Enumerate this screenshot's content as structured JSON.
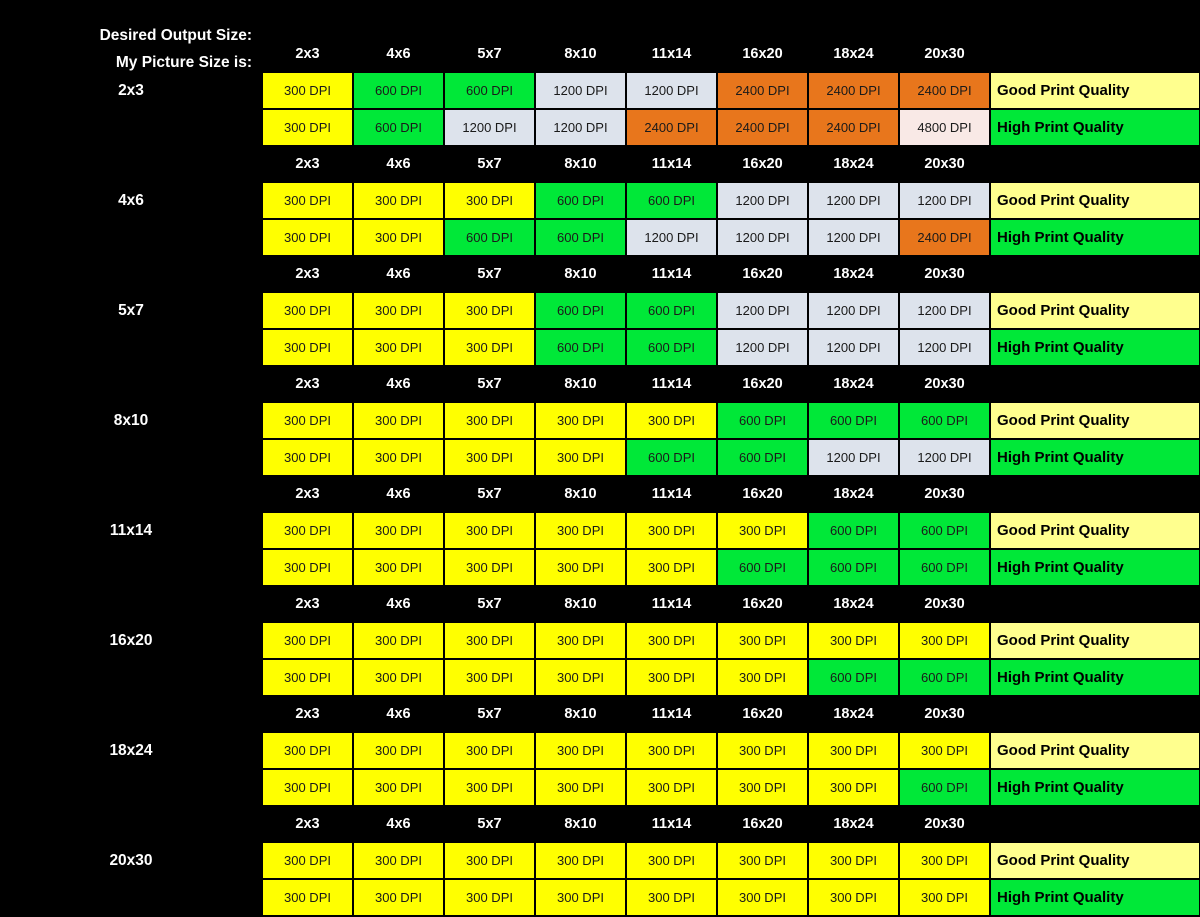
{
  "header": {
    "desired_output_size_label": "Desired Output Size:",
    "my_picture_size_label": "My Picture Size is:"
  },
  "colors": {
    "background": "#000000",
    "yellow": "#ffff00",
    "green": "#00e838",
    "blue": "#dde3ec",
    "orange": "#e8761c",
    "pink": "#f9e9e6",
    "good_quality_bg": "#ffff8e",
    "high_quality_bg": "#00e838",
    "label_text": "#ffffff"
  },
  "columns": [
    "2x3",
    "4x6",
    "5x7",
    "8x10",
    "11x14",
    "16x20",
    "18x24",
    "20x30"
  ],
  "quality_labels": {
    "good": "Good Print Quality",
    "high": "High Print Quality"
  },
  "blocks": [
    {
      "row_label": "2x3",
      "columns": [
        "2x3",
        "4x6",
        "5x7",
        "8x10",
        "11x14",
        "16x20",
        "18x24",
        "20x30"
      ],
      "good": [
        {
          "text": "300 DPI",
          "color": "yellow"
        },
        {
          "text": "600 DPI",
          "color": "green"
        },
        {
          "text": "600 DPI",
          "color": "green"
        },
        {
          "text": "1200 DPI",
          "color": "blue"
        },
        {
          "text": "1200 DPI",
          "color": "blue"
        },
        {
          "text": "2400 DPI",
          "color": "orange"
        },
        {
          "text": "2400 DPI",
          "color": "orange"
        },
        {
          "text": "2400 DPI",
          "color": "orange"
        }
      ],
      "high": [
        {
          "text": "300 DPI",
          "color": "yellow"
        },
        {
          "text": "600 DPI",
          "color": "green"
        },
        {
          "text": "1200 DPI",
          "color": "blue"
        },
        {
          "text": "1200 DPI",
          "color": "blue"
        },
        {
          "text": "2400 DPI",
          "color": "orange"
        },
        {
          "text": "2400 DPI",
          "color": "orange"
        },
        {
          "text": "2400 DPI",
          "color": "orange"
        },
        {
          "text": "4800 DPI",
          "color": "pink"
        }
      ]
    },
    {
      "row_label": "4x6",
      "columns": [
        "2x3",
        "4x6",
        "5x7",
        "8x10",
        "11x14",
        "16x20",
        "18x24",
        "20x30"
      ],
      "good": [
        {
          "text": "300 DPI",
          "color": "yellow"
        },
        {
          "text": "300 DPI",
          "color": "yellow"
        },
        {
          "text": "300 DPI",
          "color": "yellow"
        },
        {
          "text": "600 DPI",
          "color": "green"
        },
        {
          "text": "600 DPI",
          "color": "green"
        },
        {
          "text": "1200 DPI",
          "color": "blue"
        },
        {
          "text": "1200 DPI",
          "color": "blue"
        },
        {
          "text": "1200 DPI",
          "color": "blue"
        }
      ],
      "high": [
        {
          "text": "300 DPI",
          "color": "yellow"
        },
        {
          "text": "300 DPI",
          "color": "yellow"
        },
        {
          "text": "600 DPI",
          "color": "green"
        },
        {
          "text": "600 DPI",
          "color": "green"
        },
        {
          "text": "1200 DPI",
          "color": "blue"
        },
        {
          "text": "1200 DPI",
          "color": "blue"
        },
        {
          "text": "1200 DPI",
          "color": "blue"
        },
        {
          "text": "2400 DPI",
          "color": "orange"
        }
      ]
    },
    {
      "row_label": "5x7",
      "columns": [
        "2x3",
        "4x6",
        "5x7",
        "8x10",
        "11x14",
        "16x20",
        "18x24",
        "20x30"
      ],
      "good": [
        {
          "text": "300 DPI",
          "color": "yellow"
        },
        {
          "text": "300 DPI",
          "color": "yellow"
        },
        {
          "text": "300 DPI",
          "color": "yellow"
        },
        {
          "text": "600 DPI",
          "color": "green"
        },
        {
          "text": "600 DPI",
          "color": "green"
        },
        {
          "text": "1200 DPI",
          "color": "blue"
        },
        {
          "text": "1200 DPI",
          "color": "blue"
        },
        {
          "text": "1200 DPI",
          "color": "blue"
        }
      ],
      "high": [
        {
          "text": "300 DPI",
          "color": "yellow"
        },
        {
          "text": "300 DPI",
          "color": "yellow"
        },
        {
          "text": "300 DPI",
          "color": "yellow"
        },
        {
          "text": "600 DPI",
          "color": "green"
        },
        {
          "text": "600 DPI",
          "color": "green"
        },
        {
          "text": "1200 DPI",
          "color": "blue"
        },
        {
          "text": "1200 DPI",
          "color": "blue"
        },
        {
          "text": "1200 DPI",
          "color": "blue"
        }
      ]
    },
    {
      "row_label": "8x10",
      "columns": [
        "2x3",
        "4x6",
        "5x7",
        "8x10",
        "11x14",
        "16x20",
        "18x24",
        "20x30"
      ],
      "good": [
        {
          "text": "300 DPI",
          "color": "yellow"
        },
        {
          "text": "300 DPI",
          "color": "yellow"
        },
        {
          "text": "300 DPI",
          "color": "yellow"
        },
        {
          "text": "300 DPI",
          "color": "yellow"
        },
        {
          "text": "300 DPI",
          "color": "yellow"
        },
        {
          "text": "600 DPI",
          "color": "green"
        },
        {
          "text": "600 DPI",
          "color": "green"
        },
        {
          "text": "600 DPI",
          "color": "green"
        }
      ],
      "high": [
        {
          "text": "300 DPI",
          "color": "yellow"
        },
        {
          "text": "300 DPI",
          "color": "yellow"
        },
        {
          "text": "300 DPI",
          "color": "yellow"
        },
        {
          "text": "300 DPI",
          "color": "yellow"
        },
        {
          "text": "600 DPI",
          "color": "green"
        },
        {
          "text": "600 DPI",
          "color": "green"
        },
        {
          "text": "1200 DPI",
          "color": "blue"
        },
        {
          "text": "1200 DPI",
          "color": "blue"
        }
      ]
    },
    {
      "row_label": "11x14",
      "columns": [
        "2x3",
        "4x6",
        "5x7",
        "8x10",
        "11x14",
        "16x20",
        "18x24",
        "20x30"
      ],
      "good": [
        {
          "text": "300 DPI",
          "color": "yellow"
        },
        {
          "text": "300 DPI",
          "color": "yellow"
        },
        {
          "text": "300 DPI",
          "color": "yellow"
        },
        {
          "text": "300 DPI",
          "color": "yellow"
        },
        {
          "text": "300 DPI",
          "color": "yellow"
        },
        {
          "text": "300 DPI",
          "color": "yellow"
        },
        {
          "text": "600 DPI",
          "color": "green"
        },
        {
          "text": "600 DPI",
          "color": "green"
        }
      ],
      "high": [
        {
          "text": "300 DPI",
          "color": "yellow"
        },
        {
          "text": "300 DPI",
          "color": "yellow"
        },
        {
          "text": "300 DPI",
          "color": "yellow"
        },
        {
          "text": "300 DPI",
          "color": "yellow"
        },
        {
          "text": "300 DPI",
          "color": "yellow"
        },
        {
          "text": "600 DPI",
          "color": "green"
        },
        {
          "text": "600 DPI",
          "color": "green"
        },
        {
          "text": "600 DPI",
          "color": "green"
        }
      ]
    },
    {
      "row_label": "16x20",
      "columns": [
        "2x3",
        "4x6",
        "5x7",
        "8x10",
        "11x14",
        "16x20",
        "18x24",
        "20x30"
      ],
      "good": [
        {
          "text": "300 DPI",
          "color": "yellow"
        },
        {
          "text": "300 DPI",
          "color": "yellow"
        },
        {
          "text": "300 DPI",
          "color": "yellow"
        },
        {
          "text": "300 DPI",
          "color": "yellow"
        },
        {
          "text": "300 DPI",
          "color": "yellow"
        },
        {
          "text": "300 DPI",
          "color": "yellow"
        },
        {
          "text": "300 DPI",
          "color": "yellow"
        },
        {
          "text": "300 DPI",
          "color": "yellow"
        }
      ],
      "high": [
        {
          "text": "300 DPI",
          "color": "yellow"
        },
        {
          "text": "300 DPI",
          "color": "yellow"
        },
        {
          "text": "300 DPI",
          "color": "yellow"
        },
        {
          "text": "300 DPI",
          "color": "yellow"
        },
        {
          "text": "300 DPI",
          "color": "yellow"
        },
        {
          "text": "300 DPI",
          "color": "yellow"
        },
        {
          "text": "600 DPI",
          "color": "green"
        },
        {
          "text": "600 DPI",
          "color": "green"
        }
      ]
    },
    {
      "row_label": "18x24",
      "columns": [
        "2x3",
        "4x6",
        "5x7",
        "8x10",
        "11x14",
        "16x20",
        "18x24",
        "20x30"
      ],
      "good": [
        {
          "text": "300 DPI",
          "color": "yellow"
        },
        {
          "text": "300 DPI",
          "color": "yellow"
        },
        {
          "text": "300 DPI",
          "color": "yellow"
        },
        {
          "text": "300 DPI",
          "color": "yellow"
        },
        {
          "text": "300 DPI",
          "color": "yellow"
        },
        {
          "text": "300 DPI",
          "color": "yellow"
        },
        {
          "text": "300 DPI",
          "color": "yellow"
        },
        {
          "text": "300 DPI",
          "color": "yellow"
        }
      ],
      "high": [
        {
          "text": "300 DPI",
          "color": "yellow"
        },
        {
          "text": "300 DPI",
          "color": "yellow"
        },
        {
          "text": "300 DPI",
          "color": "yellow"
        },
        {
          "text": "300 DPI",
          "color": "yellow"
        },
        {
          "text": "300 DPI",
          "color": "yellow"
        },
        {
          "text": "300 DPI",
          "color": "yellow"
        },
        {
          "text": "300 DPI",
          "color": "yellow"
        },
        {
          "text": "600 DPI",
          "color": "green"
        }
      ]
    },
    {
      "row_label": "20x30",
      "columns": [
        "2x3",
        "4x6",
        "5x7",
        "8x10",
        "11x14",
        "16x20",
        "18x24",
        "20x30"
      ],
      "good": [
        {
          "text": "300 DPI",
          "color": "yellow"
        },
        {
          "text": "300 DPI",
          "color": "yellow"
        },
        {
          "text": "300 DPI",
          "color": "yellow"
        },
        {
          "text": "300 DPI",
          "color": "yellow"
        },
        {
          "text": "300 DPI",
          "color": "yellow"
        },
        {
          "text": "300 DPI",
          "color": "yellow"
        },
        {
          "text": "300 DPI",
          "color": "yellow"
        },
        {
          "text": "300 DPI",
          "color": "yellow"
        }
      ],
      "high": [
        {
          "text": "300 DPI",
          "color": "yellow"
        },
        {
          "text": "300 DPI",
          "color": "yellow"
        },
        {
          "text": "300 DPI",
          "color": "yellow"
        },
        {
          "text": "300 DPI",
          "color": "yellow"
        },
        {
          "text": "300 DPI",
          "color": "yellow"
        },
        {
          "text": "300 DPI",
          "color": "yellow"
        },
        {
          "text": "300 DPI",
          "color": "yellow"
        },
        {
          "text": "300 DPI",
          "color": "yellow"
        }
      ]
    }
  ]
}
